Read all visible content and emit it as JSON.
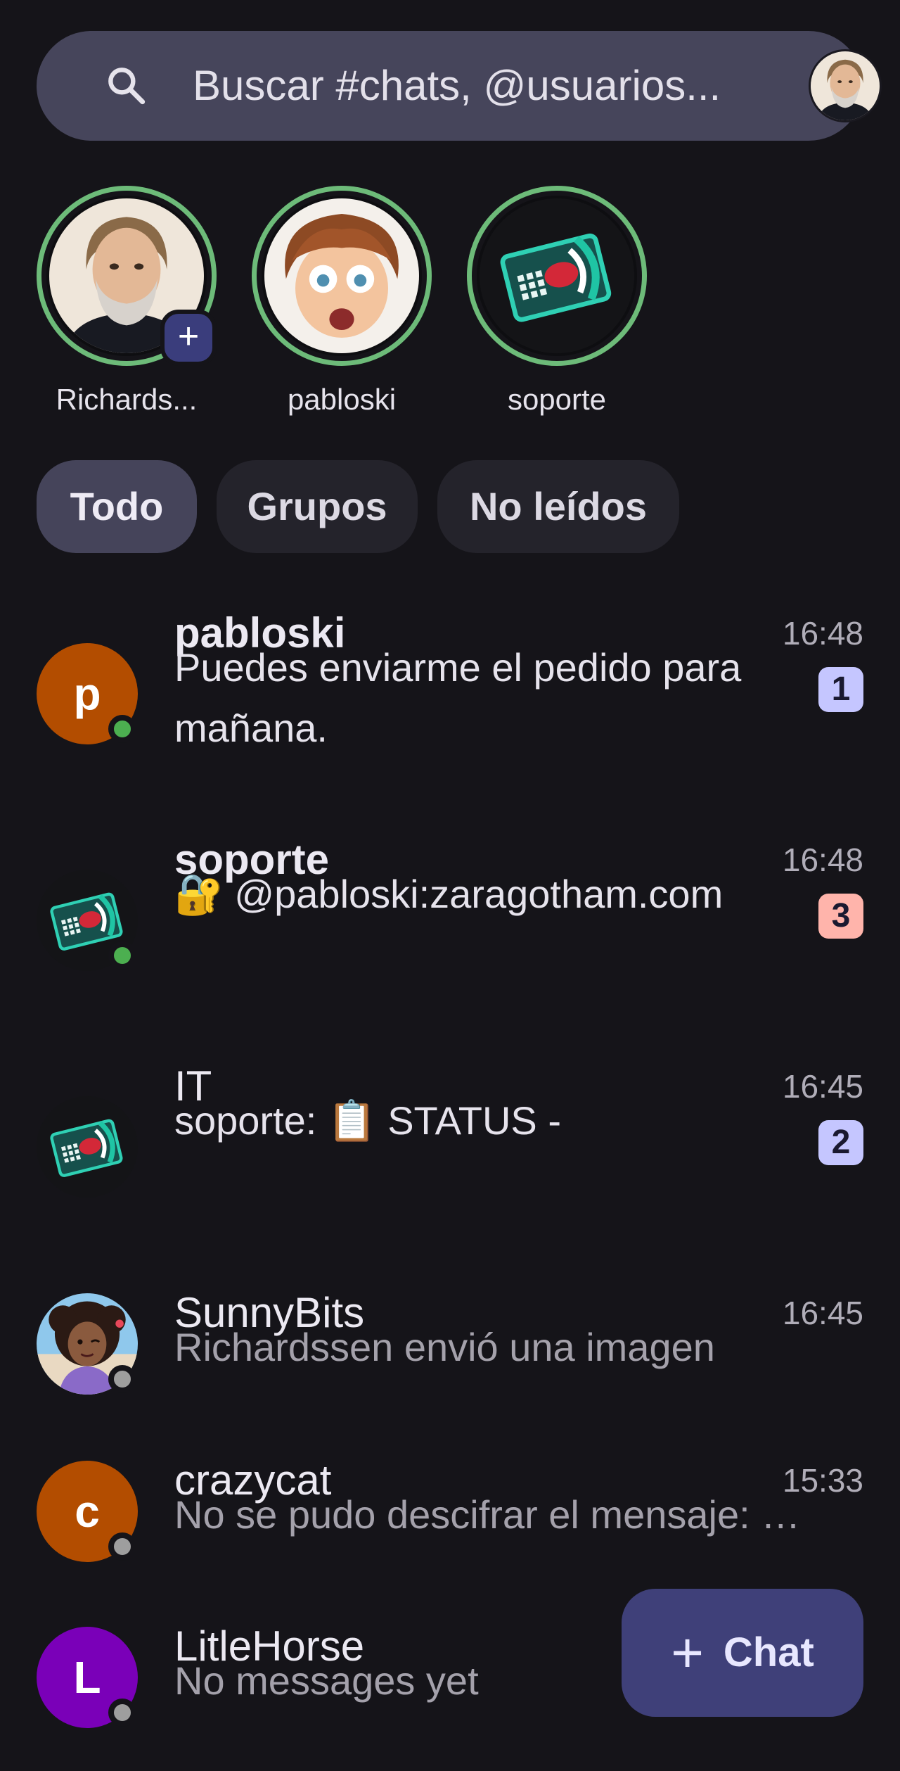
{
  "search": {
    "placeholder": "Buscar #chats, @usuarios..."
  },
  "stories": [
    {
      "name": "Richards...",
      "avatar": "man-gray-hair-avatar",
      "has_add": true
    },
    {
      "name": "pabloski",
      "avatar": "cartoon-boy-avatar",
      "has_add": false
    },
    {
      "name": "soporte",
      "avatar": "support-card-logo",
      "has_add": false
    }
  ],
  "filters": [
    {
      "label": "Todo",
      "active": true
    },
    {
      "label": "Grupos",
      "active": false
    },
    {
      "label": "No leídos",
      "active": false
    }
  ],
  "chats": [
    {
      "name": "pabloski",
      "time": "16:48",
      "message": "Puedes enviarme el pedido para mañana.",
      "unread": "1",
      "avatar_letter": "p",
      "avatar_color": "#b34d00",
      "presence": "online",
      "badge_color": "#c5c6ff"
    },
    {
      "name": "soporte",
      "time": "16:48",
      "message": "🔐 @pabloski:zaragotham.com",
      "unread": "3",
      "avatar": "support-card-logo",
      "presence": "online",
      "badge_color": "#ffb4ab"
    },
    {
      "name": "IT",
      "time": "16:45",
      "message": "soporte: 📋 STATUS -",
      "unread": "2",
      "avatar": "support-card-logo",
      "presence": "none",
      "badge_color": "#c5c6ff"
    },
    {
      "name": "SunnyBits",
      "time": "16:45",
      "message": "Richardssen envió una imagen",
      "avatar": "cartoon-girl-avatar",
      "presence": "offline"
    },
    {
      "name": "crazycat",
      "time": "15:33",
      "message": "No se pudo descifrar el mensaje: …",
      "avatar_letter": "c",
      "avatar_color": "#b34d00",
      "presence": "offline"
    },
    {
      "name": "LitleHorse",
      "message": "No messages yet",
      "avatar_letter": "L",
      "avatar_color": "#7a00b8",
      "presence": "offline"
    }
  ],
  "fab": {
    "label": "Chat",
    "icon": "plus-icon"
  },
  "colors": {
    "background": "#151419",
    "online": "#4caf50",
    "offline": "#9e9e9e",
    "story_ring": "#6dbb79",
    "fab": "#3f4079"
  }
}
